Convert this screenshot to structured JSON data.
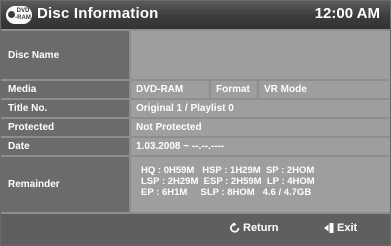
{
  "header": {
    "logo_top": "DVD",
    "logo_bottom": "-RAM",
    "title": "Disc Information",
    "clock": "12:00 AM"
  },
  "rows": {
    "disc_name": {
      "label": "Disc Name",
      "value": ""
    },
    "media": {
      "label": "Media",
      "value": "DVD-RAM",
      "format_label": "Format",
      "format_value": "VR Mode"
    },
    "title_no": {
      "label": "Title No.",
      "value": "Original 1 / Playlist 0"
    },
    "protected": {
      "label": "Protected",
      "value": "Not Protected"
    },
    "date": {
      "label": "Date",
      "value": "1.03.2008 ~ --.--.----"
    },
    "remainder": {
      "label": "Remainder",
      "lines": [
        "HQ : 0H59M   HSP : 1H29M  SP : 2HOM",
        "LSP : 2H29M  ESP : 2H59M  LP : 4HOM",
        "EP : 6H1M     SLP : 8HOM   4.6 / 4.7GB"
      ]
    }
  },
  "footer": {
    "return_label": "Return",
    "exit_label": "Exit"
  },
  "colors": {
    "header_bg": "#3c3c3c",
    "label_bg": "#6b6b6b",
    "value_bg": "#9e9e9e",
    "grid": "#8e8e8e",
    "footer_bg": "#5f5f5f",
    "text": "#ffffff"
  },
  "icons": [
    "disc-logo-icon",
    "return-icon",
    "exit-icon"
  ]
}
